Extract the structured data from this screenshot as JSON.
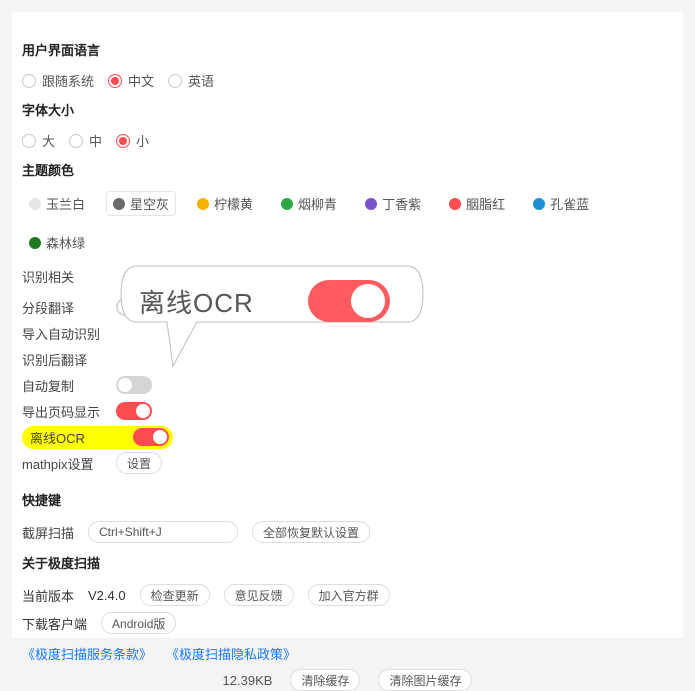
{
  "sections": {
    "ui_lang": {
      "title": "用户界面语言",
      "options": [
        "跟随系统",
        "中文",
        "英语"
      ],
      "selected": "中文"
    },
    "font_size": {
      "title": "字体大小",
      "options": [
        "大",
        "中",
        "小"
      ],
      "selected": "小"
    },
    "theme": {
      "title": "主题颜色",
      "options": [
        {
          "label": "玉兰白",
          "color": "#e6e6e6"
        },
        {
          "label": "星空灰",
          "color": "#6b6b6b"
        },
        {
          "label": "柠檬黄",
          "color": "#f5b301"
        },
        {
          "label": "烟柳青",
          "color": "#2fa84a"
        },
        {
          "label": "丁香紫",
          "color": "#7a52cc"
        },
        {
          "label": "胭脂红",
          "color": "#ff4d4f"
        },
        {
          "label": "孔雀蓝",
          "color": "#1e90d2"
        },
        {
          "label": "森林绿",
          "color": "#1f7a1f"
        }
      ],
      "selected": "星空灰"
    },
    "recognition": {
      "title": "识别相关",
      "items": [
        {
          "label": "分段翻译",
          "on": false
        },
        {
          "label": "导入自动识别",
          "on": null
        },
        {
          "label": "识别后翻译",
          "on": null
        },
        {
          "label": "自动复制",
          "on": false
        },
        {
          "label": "导出页码显示",
          "on": true
        }
      ],
      "offline_ocr": {
        "label": "离线OCR",
        "on": true
      },
      "mathpix": {
        "label": "mathpix设置",
        "btn": "设置"
      }
    },
    "hotkeys": {
      "title": "快捷键",
      "screenshot": {
        "label": "截屏扫描",
        "value": "Ctrl+Shift+J"
      },
      "reset_btn": "全部恢复默认设置"
    },
    "about": {
      "title": "关于极度扫描",
      "version_label": "当前版本",
      "version": "V2.4.0",
      "check_update": "检查更新",
      "feedback": "意见反馈",
      "join_group": "加入官方群",
      "download_label": "下载客户端",
      "download_btn": "Android版",
      "tos": "《极度扫描服务条款》",
      "privacy": "《极度扫描隐私政策》",
      "cache_size": "12.39KB",
      "clear_cache": "清除缓存",
      "clear_img_cache": "清除图片缓存"
    }
  },
  "callout": {
    "text": "离线OCR"
  }
}
